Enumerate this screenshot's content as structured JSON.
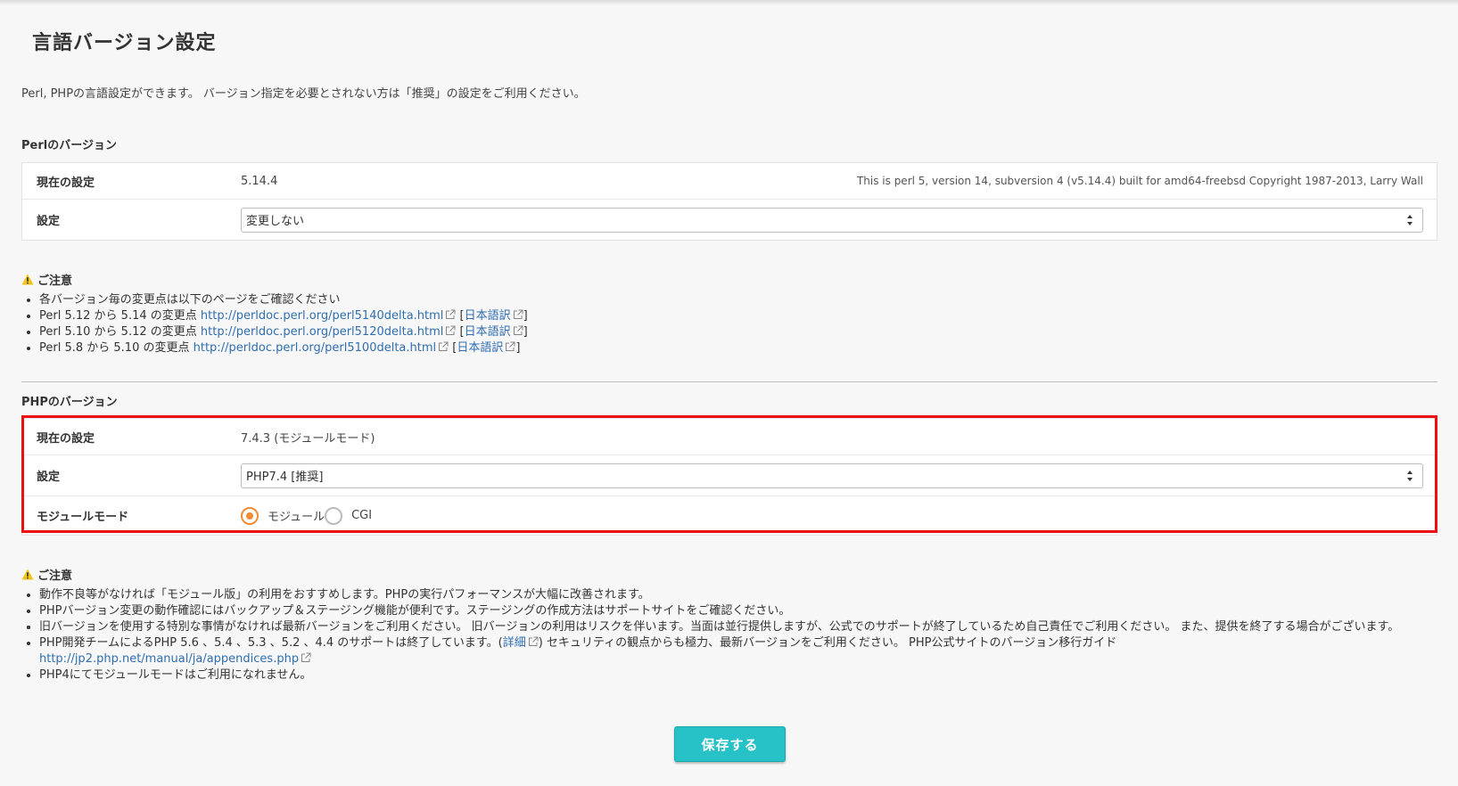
{
  "page": {
    "title": "言語バージョン設定",
    "intro": "Perl, PHPの言語設定ができます。 バージョン指定を必要とされない方は「推奨」の設定をご利用ください。"
  },
  "perl": {
    "section_title": "Perlのバージョン",
    "current_label": "現在の設定",
    "current_value": "5.14.4",
    "current_info": "This is perl 5, version 14, subversion 4 (v5.14.4) built for amd64-freebsd Copyright 1987-2013, Larry Wall",
    "setting_label": "設定",
    "setting_value": "変更しない"
  },
  "perl_notes": {
    "heading": "ご注意",
    "intro_item": "各バージョン毎の変更点は以下のページをご確認ください",
    "items": [
      {
        "prefix": "Perl 5.12 から 5.14 の変更点 ",
        "url": "http://perldoc.perl.org/perl5140delta.html",
        "ja": "日本語訳"
      },
      {
        "prefix": "Perl 5.10 から 5.12 の変更点 ",
        "url": "http://perldoc.perl.org/perl5120delta.html",
        "ja": "日本語訳"
      },
      {
        "prefix": "Perl 5.8 から 5.10 の変更点 ",
        "url": "http://perldoc.perl.org/perl5100delta.html",
        "ja": "日本語訳"
      }
    ]
  },
  "php": {
    "section_title": "PHPのバージョン",
    "current_label": "現在の設定",
    "current_value": "7.4.3 (モジュールモード)",
    "setting_label": "設定",
    "setting_value": "PHP7.4 [推奨]",
    "mode_label": "モジュールモード",
    "mode_options": [
      {
        "label": "モジュール",
        "selected": true
      },
      {
        "label": "CGI",
        "selected": false
      }
    ]
  },
  "php_notes": {
    "heading": "ご注意",
    "item1": "動作不良等がなければ「モジュール版」の利用をおすすめします。PHPの実行パフォーマンスが大幅に改善されます。",
    "item2": "PHPバージョン変更の動作確認にはバックアップ＆ステージング機能が便利です。ステージングの作成方法はサポートサイトをご確認ください。",
    "item3": "旧バージョンを使用する特別な事情がなければ最新バージョンをご利用ください。 旧バージョンの利用はリスクを伴います。当面は並行提供しますが、公式でのサポートが終了しているため自己責任でご利用ください。 また、提供を終了する場合がございます。",
    "item4_pre": "PHP開発チームによるPHP 5.6 、5.4 、5.3 、5.2 、4.4 のサポートは終了しています。(",
    "item4_link": "詳細",
    "item4_post": ") セキュリティの観点からも極力、最新バージョンをご利用ください。 PHP公式サイトのバージョン移行ガイド",
    "item4_url": "http://jp2.php.net/manual/ja/appendices.php",
    "item5": "PHP4にてモジュールモードはご利用になれません。"
  },
  "save_button": "保存する",
  "colors": {
    "accent": "#27c2c7",
    "radio": "#f28b33",
    "highlight": "#ec0f12",
    "link": "#2f6fb1",
    "warning": "#f0c419"
  }
}
